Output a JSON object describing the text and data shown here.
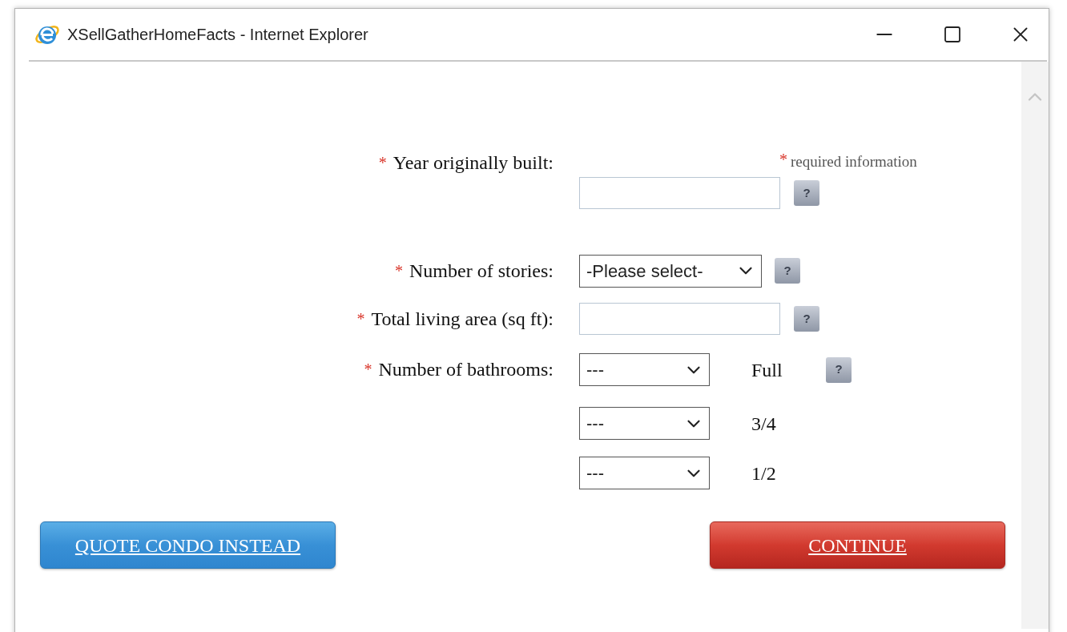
{
  "window": {
    "title": "XSellGatherHomeFacts - Internet Explorer"
  },
  "required_note": {
    "mark": "*",
    "text": "required information"
  },
  "fields": [
    {
      "kind": "text",
      "mark": "*",
      "label": "Year originally built:",
      "help": "?"
    },
    {
      "kind": "select",
      "mark": "*",
      "label": "Number of stories:",
      "value": "-Please select-",
      "help": "?"
    },
    {
      "kind": "text",
      "mark": "*",
      "label": "Total living area (sq ft):",
      "help": "?"
    },
    {
      "kind": "multi",
      "mark": "*",
      "label": "Number of bathrooms:",
      "selects": [
        {
          "value": "---",
          "unit": "Full",
          "help": "?"
        },
        {
          "value": "---",
          "unit": "3/4"
        },
        {
          "value": "---",
          "unit": "1/2"
        }
      ]
    }
  ],
  "buttons": [
    {
      "kind": "secondary",
      "label": "QUOTE CONDO INSTEAD"
    },
    {
      "kind": "primary",
      "label": "CONTINUE"
    }
  ]
}
